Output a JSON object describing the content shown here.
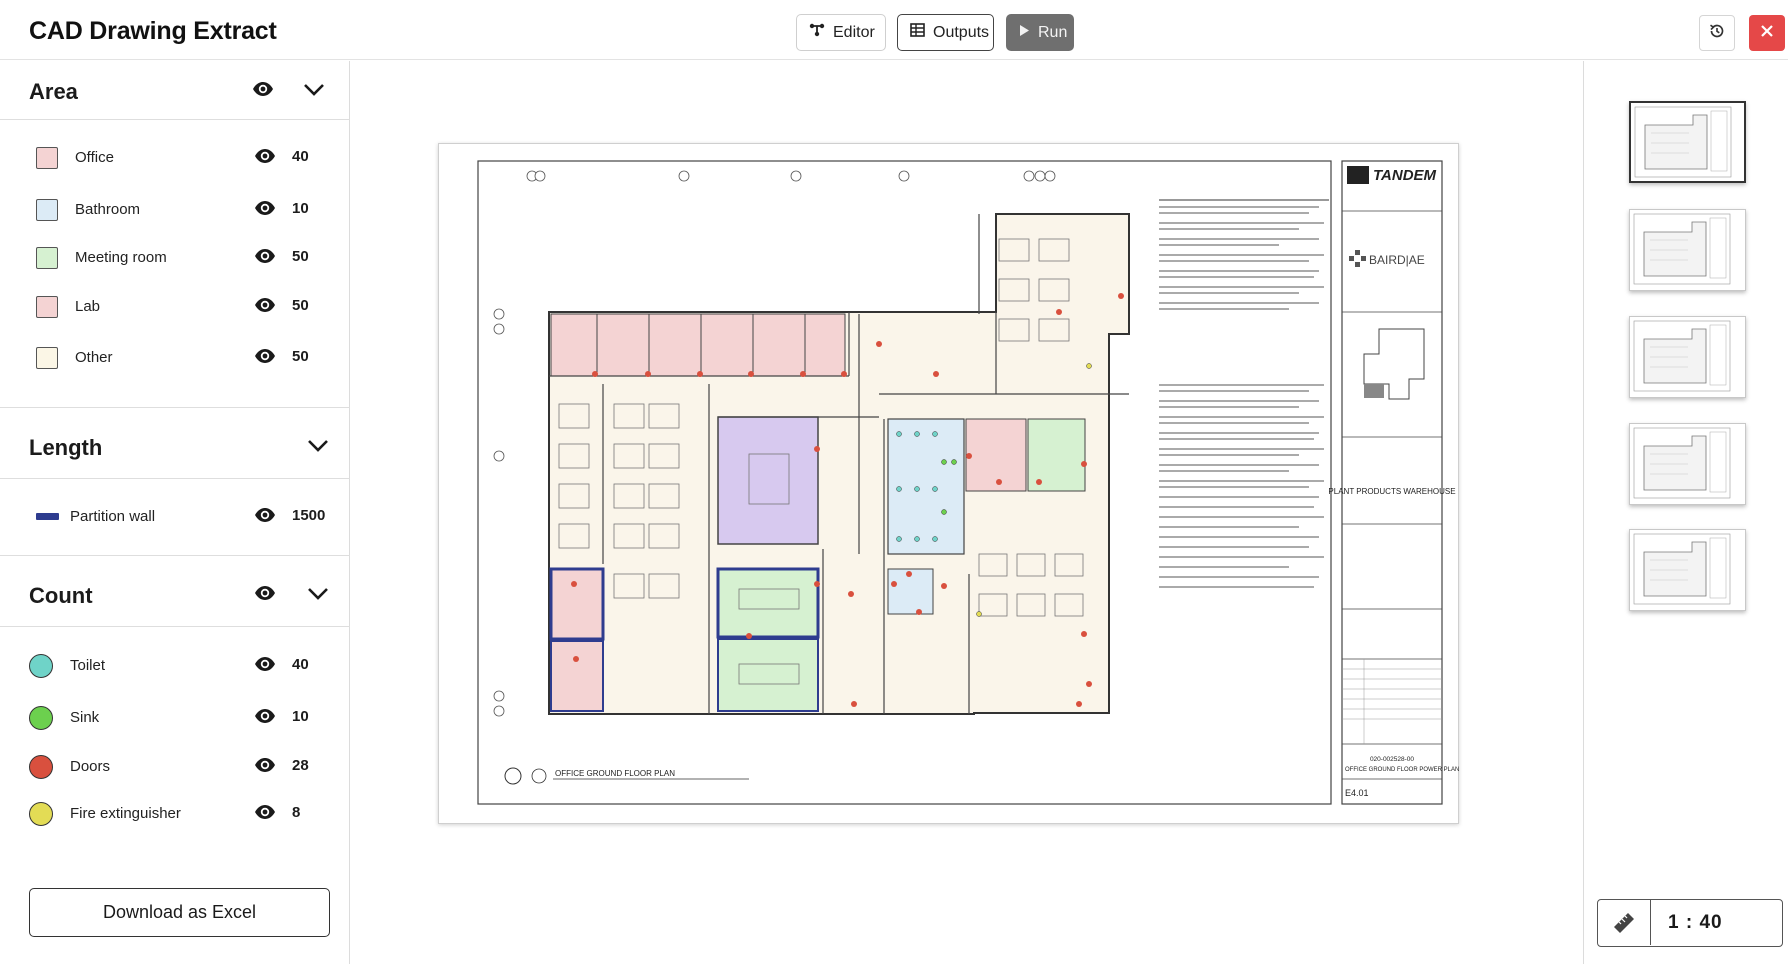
{
  "header": {
    "title": "CAD Drawing Extract",
    "editor_label": "Editor",
    "outputs_label": "Outputs",
    "run_label": "Run"
  },
  "sidebar": {
    "area": {
      "title": "Area",
      "items": [
        {
          "label": "Office",
          "value": "40",
          "color": "#f4d3d3"
        },
        {
          "label": "Bathroom",
          "value": "10",
          "color": "#dcebf6"
        },
        {
          "label": "Meeting room",
          "value": "50",
          "color": "#d6f1d1"
        },
        {
          "label": "Lab",
          "value": "50",
          "color": "#f4d3d3"
        },
        {
          "label": "Other",
          "value": "50",
          "color": "#fbf6e6"
        }
      ]
    },
    "length": {
      "title": "Length",
      "items": [
        {
          "label": "Partition wall",
          "value": "1500",
          "color": "#2e3c8f"
        }
      ]
    },
    "count": {
      "title": "Count",
      "items": [
        {
          "label": "Toilet",
          "value": "40",
          "color": "#6fd3c8"
        },
        {
          "label": "Sink",
          "value": "10",
          "color": "#6cd04e"
        },
        {
          "label": "Doors",
          "value": "28",
          "color": "#d9503e"
        },
        {
          "label": "Fire extinguisher",
          "value": "8",
          "color": "#e3dc55"
        }
      ]
    },
    "download_label": "Download as Excel"
  },
  "drawing": {
    "plan_title": "OFFICE GROUND FLOOR PLAN",
    "logo": "TANDEM",
    "consultant": "BAIRD|AE",
    "project": "PLANT PRODUCTS WAREHOUSE",
    "project_no": "020-002528-00",
    "sheet_title": "OFFICE GROUND FLOOR POWER PLAN",
    "sheet_no": "E4.01"
  },
  "right_panel": {
    "scale": "1 : 40"
  },
  "icons": {
    "editor": "nodes-icon",
    "outputs": "table-icon",
    "run": "play-icon",
    "history": "history-icon",
    "close": "close-icon",
    "visibility": "eye-icon",
    "collapse": "chevron-down-icon",
    "scale": "ruler-icon"
  }
}
